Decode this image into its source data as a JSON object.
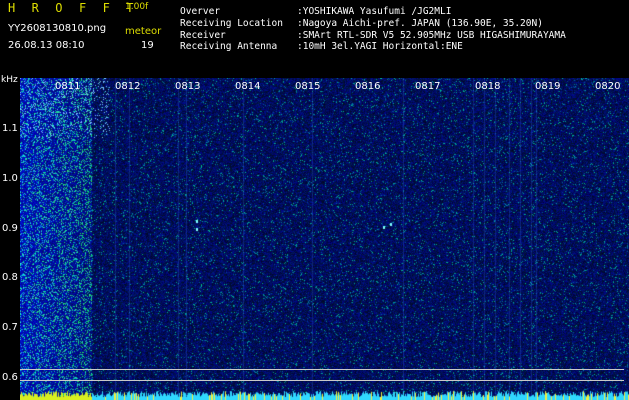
{
  "header": {
    "app_name": "H R O F F T",
    "version": "1.00f",
    "file_name": "YY2608130810.png",
    "meteor_label": "meteor",
    "timestamp": "26.08.13 08:10",
    "meteor_count": "19"
  },
  "info": [
    {
      "label": "Overver",
      "value": ":YOSHIKAWA Yasufumi /JG2MLI"
    },
    {
      "label": "Receiving Location",
      "value": ":Nagoya Aichi-pref. JAPAN (136.90E, 35.20N)"
    },
    {
      "label": "Receiver",
      "value": ":SMArt RTL-SDR V5 52.905MHz USB HIGASHIMURAYAMA"
    },
    {
      "label": "Receiving Antenna",
      "value": ":10mH 3el.YAGI Horizontal:ENE"
    }
  ],
  "axis": {
    "unit": "kHz",
    "y_ticks": [
      "1.1",
      "1.0",
      "0.9",
      "0.8",
      "0.7",
      "0.6"
    ],
    "x_ticks": [
      "0811",
      "0812",
      "0813",
      "0814",
      "0815",
      "0816",
      "0817",
      "0818",
      "0819",
      "0820"
    ]
  },
  "colors": {
    "background": "#000000",
    "label_yellow": "#dede00",
    "noise_floor": "#0a1a6e",
    "signal_cyan": "#3ff0ff"
  }
}
